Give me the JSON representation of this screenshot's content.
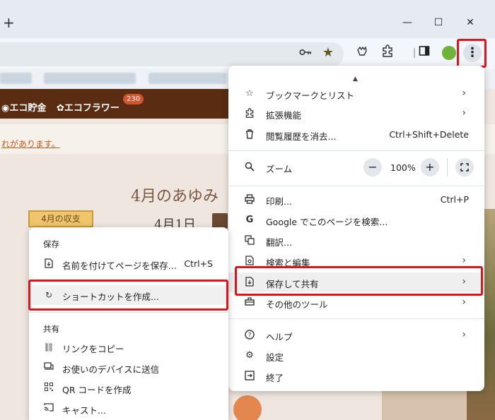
{
  "window": {
    "new_tab": "+",
    "minimize": "—",
    "maximize": "☐",
    "close": "✕"
  },
  "toolbar": {
    "menu_button": "⋮",
    "icons": [
      "key-icon",
      "star-icon",
      "reading-mode-icon",
      "extensions-icon",
      "side-panel-icon",
      "profile-icon"
    ],
    "star_color": "#5f5a1f"
  },
  "page": {
    "eco_savings": "エコ貯金",
    "eco_flower": "エコフラワー",
    "eco_badge": "230",
    "notice_link": "れがあります。",
    "title": "4月のあゆみ",
    "tag": "4月の収支",
    "date": "4月1日"
  },
  "menu": {
    "bookmarks": "ブックマークとリスト",
    "extensions": "拡張機能",
    "clear_history": "閲覧履歴を消去...",
    "clear_history_shortcut": "Ctrl+Shift+Delete",
    "zoom": "ズーム",
    "zoom_minus": "−",
    "zoom_value": "100%",
    "zoom_plus": "+",
    "print": "印刷...",
    "print_shortcut": "Ctrl+P",
    "google_search": "Google でこのページを検索...",
    "translate": "翻訳...",
    "search_edit": "検索と編集",
    "save_share": "保存して共有",
    "more_tools": "その他のツール",
    "help": "ヘルプ",
    "settings": "設定",
    "exit": "終了"
  },
  "submenu": {
    "save_header": "保存",
    "save_page": "名前を付けてページを保存...",
    "save_page_shortcut": "Ctrl+S",
    "create_shortcut": "ショートカットを作成...",
    "share_header": "共有",
    "copy_link": "リンクをコピー",
    "send_to_device": "お使いのデバイスに送信",
    "qr_code": "QR コードを作成",
    "cast": "キャスト..."
  },
  "colors": {
    "highlight_border": "#e0131a",
    "brand_brown": "#5a2d12"
  }
}
